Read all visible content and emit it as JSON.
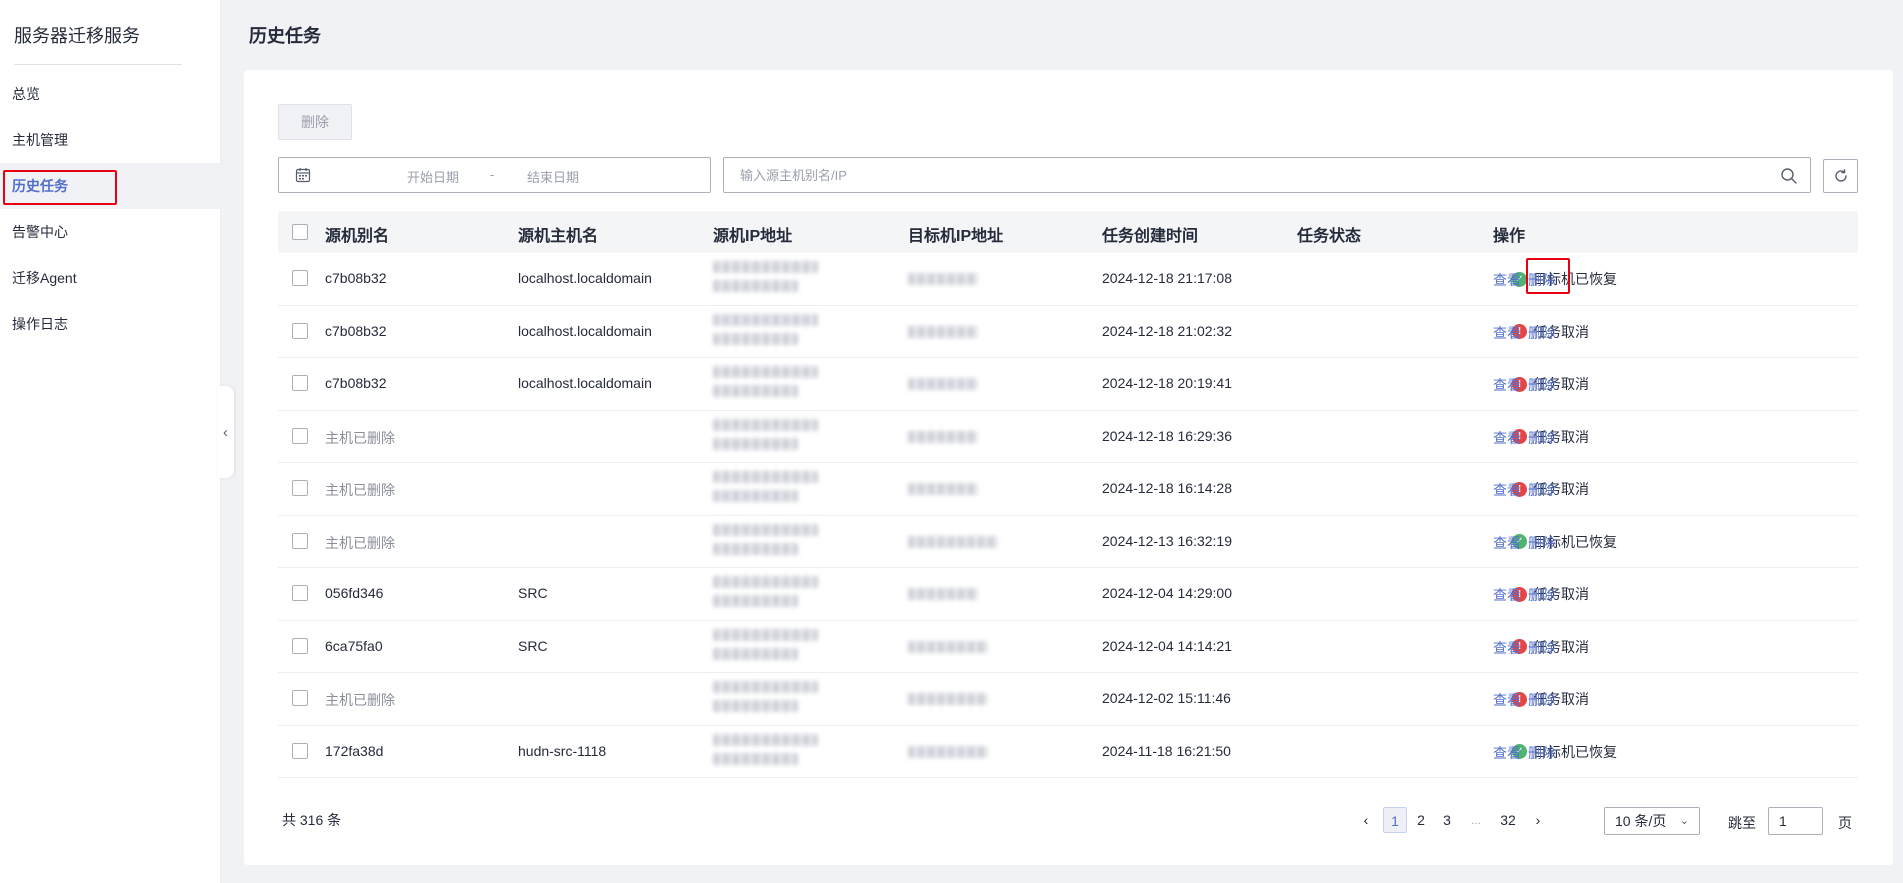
{
  "sidebar": {
    "title": "服务器迁移服务",
    "items": [
      {
        "label": "总览"
      },
      {
        "label": "主机管理"
      },
      {
        "label": "历史任务"
      },
      {
        "label": "告警中心"
      },
      {
        "label": "迁移Agent"
      },
      {
        "label": "操作日志"
      }
    ],
    "active_index": 2
  },
  "page": {
    "title": "历史任务"
  },
  "toolbar": {
    "delete_label": "删除",
    "start_date_placeholder": "开始日期",
    "date_separator": "-",
    "end_date_placeholder": "结束日期",
    "search_placeholder": "输入源主机别名/IP"
  },
  "table": {
    "columns": [
      "源机别名",
      "源机主机名",
      "源机IP地址",
      "目标机IP地址",
      "任务创建时间",
      "任务状态",
      "操作"
    ],
    "view_label": "查看",
    "delete_label": "删除",
    "rows": [
      {
        "alias": "c7b08b32",
        "hostname": "localhost.localdomain",
        "created": "2024-12-18 21:17:08",
        "status": "目标机已恢复",
        "status_type": "ok",
        "deleted": false
      },
      {
        "alias": "c7b08b32",
        "hostname": "localhost.localdomain",
        "created": "2024-12-18 21:02:32",
        "status": "任务取消",
        "status_type": "err",
        "deleted": false
      },
      {
        "alias": "c7b08b32",
        "hostname": "localhost.localdomain",
        "created": "2024-12-18 20:19:41",
        "status": "任务取消",
        "status_type": "err",
        "deleted": false
      },
      {
        "alias": "主机已删除",
        "hostname": "",
        "created": "2024-12-18 16:29:36",
        "status": "任务取消",
        "status_type": "err",
        "deleted": true
      },
      {
        "alias": "主机已删除",
        "hostname": "",
        "created": "2024-12-18 16:14:28",
        "status": "任务取消",
        "status_type": "err",
        "deleted": true
      },
      {
        "alias": "主机已删除",
        "hostname": "",
        "created": "2024-12-13 16:32:19",
        "status": "目标机已恢复",
        "status_type": "ok",
        "deleted": true
      },
      {
        "alias": "056fd346",
        "hostname": "SRC",
        "created": "2024-12-04 14:29:00",
        "status": "任务取消",
        "status_type": "err",
        "deleted": false
      },
      {
        "alias": "6ca75fa0",
        "hostname": "SRC",
        "created": "2024-12-04 14:14:21",
        "status": "任务取消",
        "status_type": "err",
        "deleted": false
      },
      {
        "alias": "主机已删除",
        "hostname": "",
        "created": "2024-12-02 15:11:46",
        "status": "任务取消",
        "status_type": "err",
        "deleted": true
      },
      {
        "alias": "172fa38d",
        "hostname": "hudn-src-1118",
        "created": "2024-11-18 16:21:50",
        "status": "目标机已恢复",
        "status_type": "ok",
        "deleted": false
      }
    ]
  },
  "pagination": {
    "total_label": "共 316 条",
    "pages": [
      "1",
      "2",
      "3",
      "...",
      "32"
    ],
    "current_page": "1",
    "page_size": "10 条/页",
    "jump_label": "跳至",
    "jump_value": "1",
    "page_unit": "页"
  },
  "icons": {
    "calendar": "calendar-icon",
    "search": "search-icon",
    "refresh": "refresh-icon",
    "status_ok": "check-circle-icon",
    "status_err": "exclamation-circle-icon",
    "collapse": "chevron-left-icon"
  },
  "colors": {
    "accent": "#526ecc",
    "success": "#50b371",
    "error": "#e54545",
    "highlight": "#e60012"
  }
}
